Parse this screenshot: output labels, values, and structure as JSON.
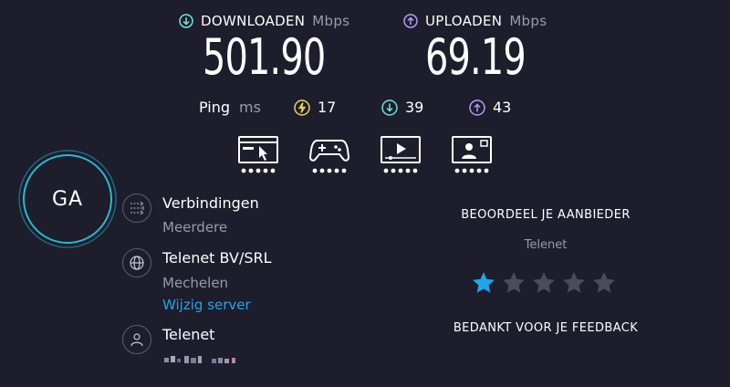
{
  "download": {
    "label": "DOWNLOADEN",
    "unit": "Mbps",
    "value": "501.90",
    "icon": "download-icon",
    "color": "#6fe3e0"
  },
  "upload": {
    "label": "UPLOADEN",
    "unit": "Mbps",
    "value": "69.19",
    "icon": "upload-icon",
    "color": "#b79cf2"
  },
  "ping": {
    "label": "Ping",
    "unit": "ms",
    "idle": {
      "value": "17",
      "icon": "latency-icon",
      "color": "#ecd85a"
    },
    "download": {
      "value": "39",
      "icon": "download-latency-icon",
      "color": "#6fe3e0"
    },
    "upload": {
      "value": "43",
      "icon": "upload-latency-icon",
      "color": "#b79cf2"
    }
  },
  "app_ratings": [
    {
      "icon": "web-browsing-icon",
      "dots": 5
    },
    {
      "icon": "gaming-icon",
      "dots": 5
    },
    {
      "icon": "video-streaming-icon",
      "dots": 5
    },
    {
      "icon": "video-chat-icon",
      "dots": 5
    }
  ],
  "go_button": {
    "label": "GA"
  },
  "connections": {
    "title": "Verbindingen",
    "value": "Meerdere",
    "icon": "connections-icon"
  },
  "server": {
    "name": "Telenet BV/SRL",
    "location": "Mechelen",
    "change_link": "Wijzig server",
    "icon": "globe-icon"
  },
  "isp": {
    "name": "Telenet",
    "icon": "user-icon"
  },
  "rating": {
    "title": "BEOORDEEL JE AANBIEDER",
    "provider": "Telenet",
    "stars_total": 5,
    "stars_selected": 1,
    "feedback": "BEDANKT VOOR JE FEEDBACK",
    "active_color": "#1fa5e8",
    "inactive_color": "#4b4b5e"
  },
  "colors": {
    "background": "#1d1d2c",
    "link": "#1fa5e8",
    "ring": "#2ab8cf"
  }
}
